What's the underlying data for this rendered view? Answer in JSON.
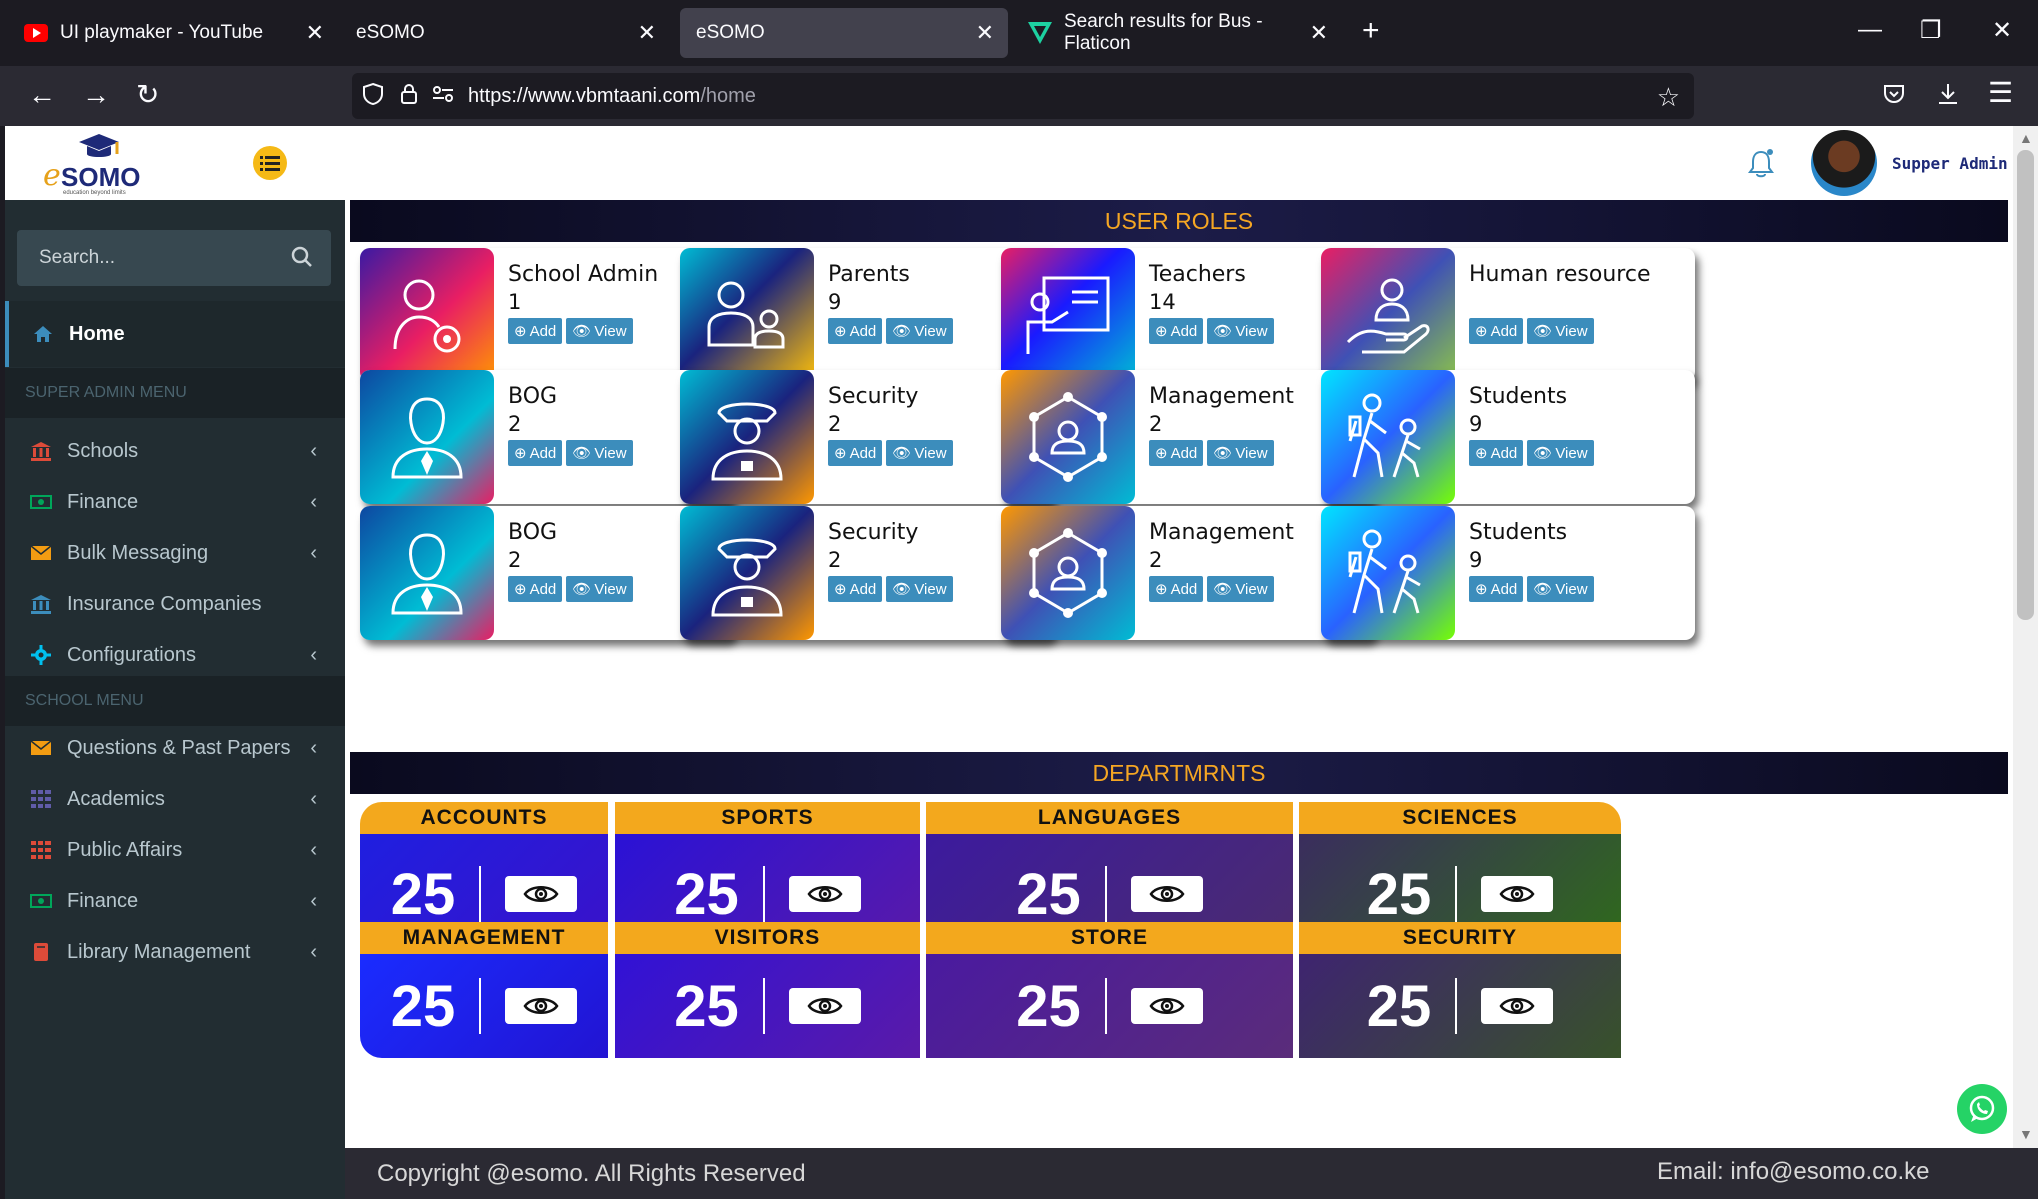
{
  "browser": {
    "tabs": [
      {
        "label": "UI playmaker - YouTube"
      },
      {
        "label": "eSOMO"
      },
      {
        "label": "eSOMO"
      },
      {
        "label": "Search results for Bus - Flaticon"
      }
    ],
    "url_host": "https://www.vbmtaani.com",
    "url_path": "/home"
  },
  "app": {
    "logo_text": "SOMO",
    "logo_e": "e",
    "logo_tagline": "education beyond limits",
    "user_name": "Supper Admin"
  },
  "sidebar": {
    "search_placeholder": "Search...",
    "home": "Home",
    "super_admin_header": "SUPER ADMIN MENU",
    "school_header": "SCHOOL MENU",
    "super_items": [
      {
        "label": "Schools"
      },
      {
        "label": "Finance"
      },
      {
        "label": "Bulk Messaging"
      },
      {
        "label": "Insurance Companies"
      },
      {
        "label": "Configurations"
      }
    ],
    "school_items": [
      {
        "label": "Questions & Past Papers"
      },
      {
        "label": "Academics"
      },
      {
        "label": "Public Affairs"
      },
      {
        "label": "Finance"
      },
      {
        "label": "Library Management"
      }
    ]
  },
  "roles": {
    "title": "USER ROLES",
    "add_label": "Add",
    "view_label": "View",
    "cards": [
      {
        "title": "School Admin",
        "count": "1"
      },
      {
        "title": "Parents",
        "count": "9"
      },
      {
        "title": "Teachers",
        "count": "14"
      },
      {
        "title": "Human resource",
        "count": ""
      },
      {
        "title": "BOG",
        "count": "2"
      },
      {
        "title": "Security",
        "count": "2"
      },
      {
        "title": "Management",
        "count": "2"
      },
      {
        "title": "Students",
        "count": "9"
      },
      {
        "title": "BOG",
        "count": "2"
      },
      {
        "title": "Security",
        "count": "2"
      },
      {
        "title": "Management",
        "count": "2"
      },
      {
        "title": "Students",
        "count": "9"
      }
    ]
  },
  "departments": {
    "title": "DEPARTMRNTS",
    "items": [
      {
        "name": "ACCOUNTS",
        "count": "25"
      },
      {
        "name": "SPORTS",
        "count": "25"
      },
      {
        "name": "LANGUAGES",
        "count": "25"
      },
      {
        "name": "SCIENCES",
        "count": "25"
      },
      {
        "name": "MANAGEMENT",
        "count": "25"
      },
      {
        "name": "VISITORS",
        "count": "25"
      },
      {
        "name": "STORE",
        "count": "25"
      },
      {
        "name": "SECURITY",
        "count": "25"
      }
    ]
  },
  "footer": {
    "copyright": "Copyright @esomo.  All Rights Reserved",
    "email": "Email: info@esomo.co.ke"
  },
  "colors": {
    "accent_blue": "#3c8dbc",
    "dept_header": "#f3a81d",
    "section_text": "#f5a623",
    "sidebar_bg": "#222d32"
  }
}
